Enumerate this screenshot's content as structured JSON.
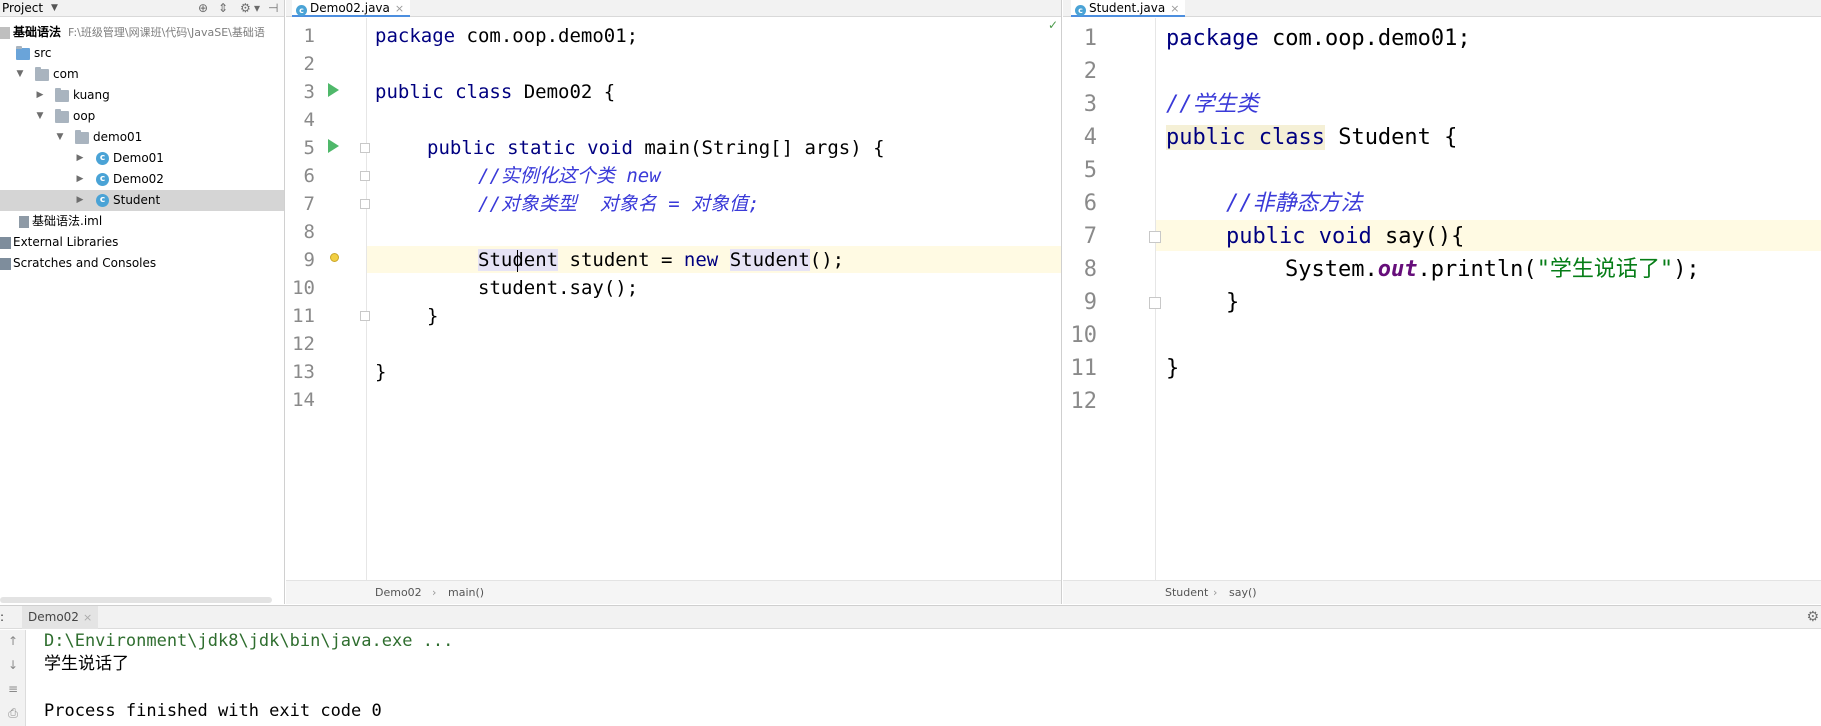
{
  "project": {
    "title": "Project",
    "root_name": "基础语法",
    "root_path": "F:\\班级管理\\网课班\\代码\\JavaSE\\基础语",
    "tree": [
      {
        "label": "src"
      },
      {
        "label": "com"
      },
      {
        "label": "kuang"
      },
      {
        "label": "oop"
      },
      {
        "label": "demo01"
      },
      {
        "label": "Demo01"
      },
      {
        "label": "Demo02"
      },
      {
        "label": "Student"
      },
      {
        "label": "基础语法.iml"
      },
      {
        "label": "External Libraries"
      },
      {
        "label": "Scratches and Consoles"
      }
    ]
  },
  "left_editor": {
    "tab": "Demo02.java",
    "close": "×",
    "line_numbers": [
      "1",
      "2",
      "3",
      "4",
      "5",
      "6",
      "7",
      "8",
      "9",
      "10",
      "11",
      "12",
      "13",
      "14"
    ],
    "lines": {
      "l1_kw": "package",
      "l1_rest": " com.oop.demo01;",
      "l3_kw": "public class",
      "l3_rest": " Demo02 {",
      "l5_kw": "public static void",
      "l5_rest": " main(String[] args) {",
      "l6": "//实例化这个类 new",
      "l7": "//对象类型  对象名 = 对象值;",
      "l9_type": "Student",
      "l9_mid": " student = ",
      "l9_kw": "new",
      "l9_ctor": "Student",
      "l9_end": "();",
      "l10": "student.say();",
      "l11": "}",
      "l13": "}"
    },
    "breadcrumb": [
      "Demo02",
      "main()"
    ]
  },
  "right_editor": {
    "tab": "Student.java",
    "close": "×",
    "line_numbers": [
      "1",
      "2",
      "3",
      "4",
      "5",
      "6",
      "7",
      "8",
      "9",
      "10",
      "11",
      "12"
    ],
    "lines": {
      "l1_kw": "package",
      "l1_rest": " com.oop.demo01;",
      "l3": "//学生类",
      "l4_kw": "public class",
      "l4_rest": " Student {",
      "l6": "//非静态方法",
      "l7_kw": "public void",
      "l7_rest": " say(){",
      "l8_a": "System.",
      "l8_field": "out",
      "l8_b": ".println(",
      "l8_str": "\"学生说话了\"",
      "l8_c": ");",
      "l9": "}",
      "l11": "}"
    },
    "breadcrumb": [
      "Student",
      "say()"
    ]
  },
  "run": {
    "label": ":",
    "tab": "Demo02",
    "close": "×",
    "gear": "⚙",
    "lines": [
      "D:\\Environment\\jdk8\\jdk\\bin\\java.exe ...",
      "学生说话了",
      "",
      "Process finished with exit code 0"
    ]
  },
  "colors": {
    "keyword": "#000080",
    "comment": "#3a3ad8",
    "string": "#067d17",
    "field": "#660e7a",
    "console_path": "#2f6e2f",
    "caret_line": "#fffae3"
  }
}
